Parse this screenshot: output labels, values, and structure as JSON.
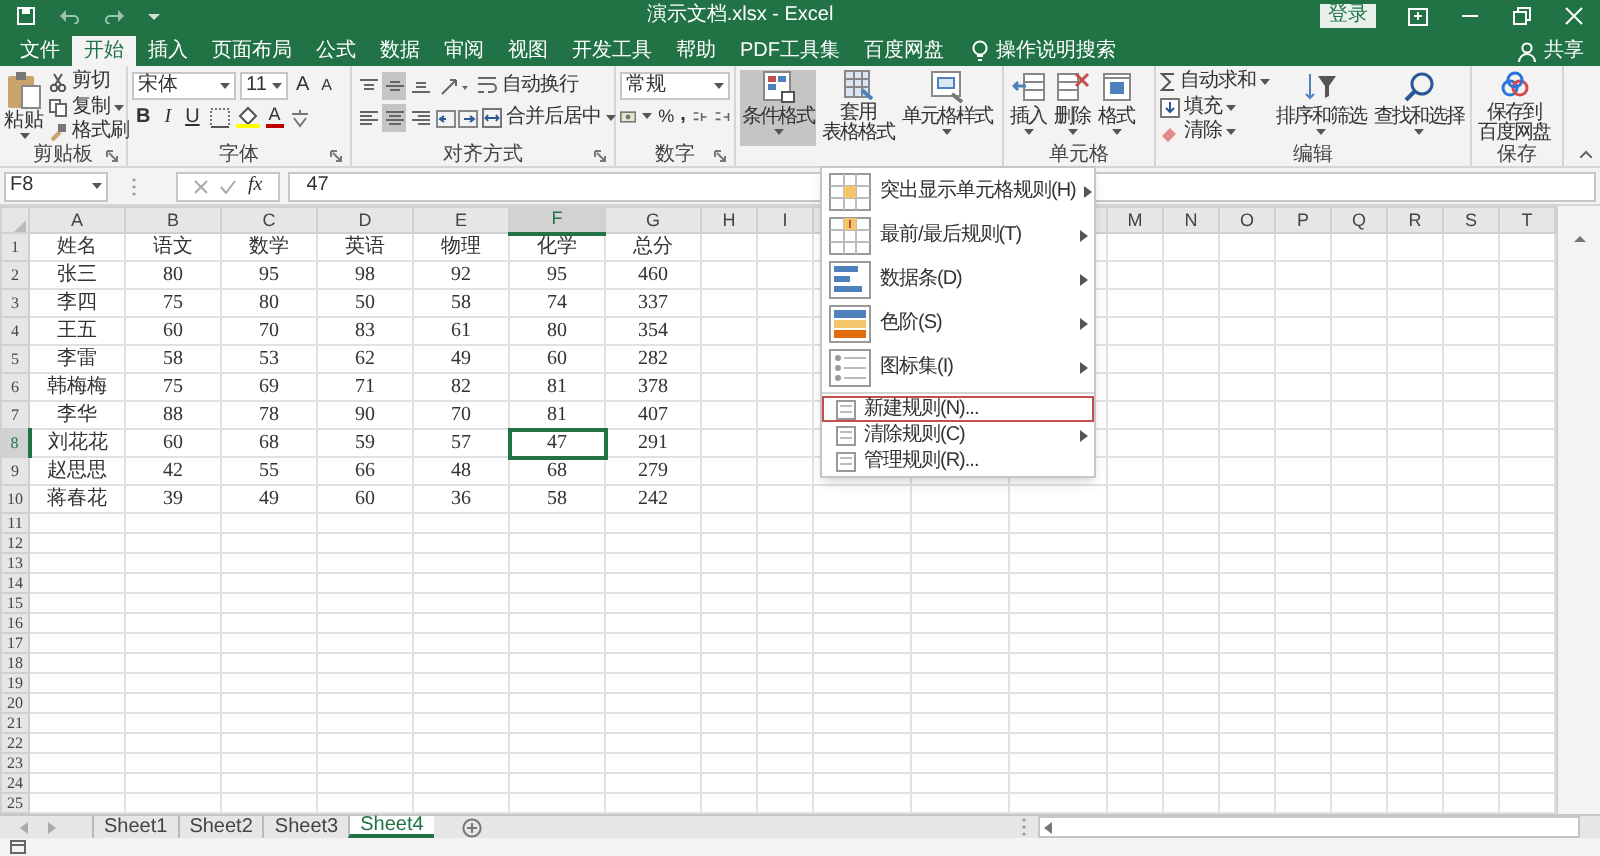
{
  "window": {
    "title": "演示文档.xlsx - Excel",
    "login": "登录"
  },
  "tabs": [
    {
      "label": "文件",
      "selected": false
    },
    {
      "label": "开始",
      "selected": true
    },
    {
      "label": "插入",
      "selected": false
    },
    {
      "label": "页面布局",
      "selected": false
    },
    {
      "label": "公式",
      "selected": false
    },
    {
      "label": "数据",
      "selected": false
    },
    {
      "label": "审阅",
      "selected": false
    },
    {
      "label": "视图",
      "selected": false
    },
    {
      "label": "开发工具",
      "selected": false
    },
    {
      "label": "帮助",
      "selected": false
    },
    {
      "label": "PDF工具集",
      "selected": false
    },
    {
      "label": "百度网盘",
      "selected": false
    }
  ],
  "tell_me": "操作说明搜索",
  "share": "共享",
  "ribbon": {
    "clipboard": {
      "label": "剪贴板",
      "paste": "粘贴",
      "cut": "剪切",
      "copy": "复制",
      "format_painter": "格式刷"
    },
    "font": {
      "label": "字体",
      "font_name": "宋体",
      "font_size": "11",
      "grow": "A",
      "shrink": "A",
      "bold": "B",
      "italic": "I",
      "underline": "U",
      "font_color": "A"
    },
    "alignment": {
      "label": "对齐方式",
      "wrap_text": "自动换行",
      "merge_center": "合并后居中",
      "vertical": [
        {
          "selected": false
        },
        {
          "selected": true
        },
        {
          "selected": false
        }
      ],
      "horizontal": [
        {
          "selected": false
        },
        {
          "selected": true
        },
        {
          "selected": false
        }
      ]
    },
    "number": {
      "label": "数字",
      "format": "常规",
      "percent": "%",
      "comma": ","
    },
    "styles": {
      "conditional_formatting": "条件格式",
      "conditional_pressed": true,
      "format_as_table": [
        "套用",
        "表格格式"
      ],
      "cell_styles": "单元格样式"
    },
    "cells": {
      "label": "单元格",
      "insert": "插入",
      "delete": "删除",
      "format": "格式"
    },
    "editing": {
      "label": "编辑",
      "autosum": "自动求和",
      "fill": "填充",
      "clear": "清除",
      "sort_filter": "排序和筛选",
      "find_select": "查找和选择"
    },
    "save": {
      "label": "保存",
      "save_to_baidu": [
        "保存到",
        "百度网盘"
      ]
    }
  },
  "formula_bar": {
    "name_box": "F8",
    "function_label": "fx",
    "value": "47"
  },
  "sheet": {
    "columns": [
      {
        "label": "A",
        "selected": false
      },
      {
        "label": "B",
        "selected": false
      },
      {
        "label": "C",
        "selected": false
      },
      {
        "label": "D",
        "selected": false
      },
      {
        "label": "E",
        "selected": false
      },
      {
        "label": "F",
        "selected": true
      },
      {
        "label": "G",
        "selected": false
      },
      {
        "label": "H",
        "selected": false
      },
      {
        "label": "I",
        "selected": false
      },
      {
        "kind": "covered"
      },
      {
        "kind": "covered"
      },
      {
        "kind": "covered"
      },
      {
        "label": "M",
        "selected": false
      },
      {
        "label": "N",
        "selected": false
      },
      {
        "label": "O",
        "selected": false
      },
      {
        "label": "P",
        "selected": false
      },
      {
        "label": "Q",
        "selected": false
      },
      {
        "label": "R",
        "selected": false
      },
      {
        "label": "S",
        "selected": false
      },
      {
        "label": "T",
        "selected": false
      }
    ],
    "rows": [
      {
        "number": "1",
        "selected": false,
        "cells": [
          "姓名",
          "语文",
          "数学",
          "英语",
          "物理",
          "化学",
          "总分"
        ]
      },
      {
        "number": "2",
        "selected": false,
        "cells": [
          "张三",
          "80",
          "95",
          "98",
          "92",
          "95",
          "460"
        ]
      },
      {
        "number": "3",
        "selected": false,
        "cells": [
          "李四",
          "75",
          "80",
          "50",
          "58",
          "74",
          "337"
        ]
      },
      {
        "number": "4",
        "selected": false,
        "cells": [
          "王五",
          "60",
          "70",
          "83",
          "61",
          "80",
          "354"
        ]
      },
      {
        "number": "5",
        "selected": false,
        "cells": [
          "李雷",
          "58",
          "53",
          "62",
          "49",
          "60",
          "282"
        ]
      },
      {
        "number": "6",
        "selected": false,
        "cells": [
          "韩梅梅",
          "75",
          "69",
          "71",
          "82",
          "81",
          "378"
        ]
      },
      {
        "number": "7",
        "selected": false,
        "cells": [
          "李华",
          "88",
          "78",
          "90",
          "70",
          "81",
          "407"
        ]
      },
      {
        "number": "8",
        "selected": true,
        "cells": [
          "刘花花",
          "60",
          "68",
          "59",
          "57",
          "47",
          "291"
        ]
      },
      {
        "number": "9",
        "selected": false,
        "cells": [
          "赵思思",
          "42",
          "55",
          "66",
          "48",
          "68",
          "279"
        ]
      },
      {
        "number": "10",
        "selected": false,
        "cells": [
          "蒋春花",
          "39",
          "49",
          "60",
          "36",
          "58",
          "242"
        ]
      },
      {
        "number": "11",
        "selected": false
      },
      {
        "number": "12",
        "selected": false
      },
      {
        "number": "13",
        "selected": false
      },
      {
        "number": "14",
        "selected": false
      },
      {
        "number": "15",
        "selected": false
      },
      {
        "number": "16",
        "selected": false
      },
      {
        "number": "17",
        "selected": false
      },
      {
        "number": "18",
        "selected": false
      },
      {
        "number": "19",
        "selected": false
      },
      {
        "number": "20",
        "selected": false
      },
      {
        "number": "21",
        "selected": false
      },
      {
        "number": "22",
        "selected": false
      },
      {
        "number": "23",
        "selected": false
      },
      {
        "number": "24",
        "selected": false
      },
      {
        "number": "25",
        "selected": false
      }
    ]
  },
  "menu": {
    "items": [
      {
        "kind": "gallery",
        "label": "突出显示单元格规则(H)",
        "submenu": true,
        "selected": false
      },
      {
        "kind": "gallery",
        "label": "最前/最后规则(T)",
        "submenu": true,
        "selected": false
      },
      {
        "kind": "gallery",
        "label": "数据条(D)",
        "submenu": true,
        "selected": false
      },
      {
        "kind": "gallery",
        "label": "色阶(S)",
        "submenu": true,
        "selected": false
      },
      {
        "kind": "gallery",
        "label": "图标集(I)",
        "submenu": true,
        "selected": false
      },
      {
        "kind": "command",
        "label": "新建规则(N)...",
        "submenu": false,
        "selected": true
      },
      {
        "kind": "command",
        "label": "清除规则(C)",
        "submenu": true,
        "selected": false
      },
      {
        "kind": "command",
        "label": "管理规则(R)...",
        "submenu": false,
        "selected": false
      }
    ]
  },
  "sheet_tabs": [
    {
      "label": "Sheet1",
      "selected": false
    },
    {
      "label": "Sheet2",
      "selected": false
    },
    {
      "label": "Sheet3",
      "selected": false
    },
    {
      "label": "Sheet4",
      "selected": true
    }
  ]
}
